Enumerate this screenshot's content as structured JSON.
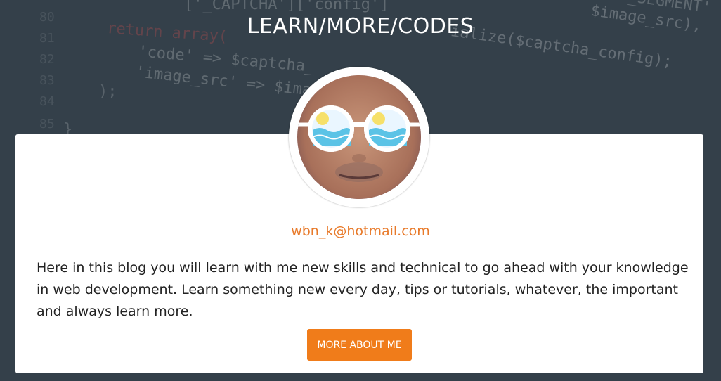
{
  "header": {
    "title": "LEARN/MORE/CODES"
  },
  "background_code": {
    "line_numbers": [
      "80",
      "81",
      "82",
      "83",
      "84",
      "85"
    ],
    "lines": [
      "['_CAPTCHA']['config']",
      "return array(",
      "'code' => $captcha_",
      "'image_src' => $imag",
      ");",
      "}",
      "$image_src),",
      "ialize($captcha_config);",
      "'_SEGMENT'"
    ]
  },
  "profile": {
    "email": "wbn_k@hotmail.com",
    "bio": "Here in this blog you will learn with me new skills and technical to go ahead with your knowledge in web development. Learn something new every day, tips or tutorials, whatever, the important and always learn more.",
    "button_label": "MORE ABOUT ME"
  },
  "colors": {
    "background": "#34404a",
    "accent": "#f07c1a",
    "email": "#e87a2a",
    "card": "#ffffff"
  }
}
